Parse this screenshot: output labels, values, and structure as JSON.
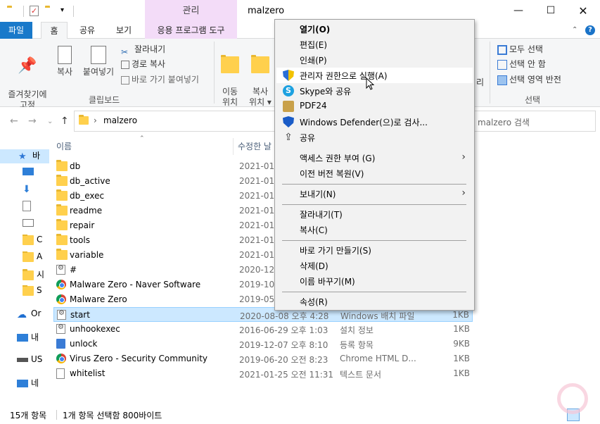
{
  "titlebar": {
    "title": "malzero",
    "context_tab": "관리",
    "min_glyph": "—",
    "max_glyph": "☐",
    "close_glyph": "✕"
  },
  "ribbon_tabs": {
    "file": "파일",
    "home": "홈",
    "share": "공유",
    "view": "보기",
    "app_tools": "응용 프로그램 도구"
  },
  "ribbon": {
    "pin_label": "즐겨찾기에\n고정",
    "copy_label": "복사",
    "paste_label": "붙여넣기",
    "cut_label": "잘라내기",
    "copy_path_label": "경로 복사",
    "paste_shortcut_label": "바로 가기 붙여넣기",
    "clipboard_group": "클립보드",
    "move_label": "이동\n위치 ▾",
    "copyto_label": "복사\n위치 ▾",
    "partial_label": "리",
    "select_all": "모두 선택",
    "select_none": "선택 안 함",
    "invert_selection": "선택 영역 반전",
    "select_group": "선택"
  },
  "address": {
    "path": "malzero",
    "search_placeholder": "malzero 검색"
  },
  "navpane": {
    "items": [
      "바",
      "",
      "",
      "",
      "",
      "C",
      "A",
      "시",
      "S",
      "Or",
      "내",
      "US",
      "네"
    ]
  },
  "columns": {
    "name": "이름",
    "date": "수정한 날"
  },
  "files": [
    {
      "icon": "folder",
      "name": "db",
      "date": "2021-01-",
      "type": "",
      "size": ""
    },
    {
      "icon": "folder",
      "name": "db_active",
      "date": "2021-01-",
      "type": "",
      "size": ""
    },
    {
      "icon": "folder",
      "name": "db_exec",
      "date": "2021-01-",
      "type": "",
      "size": ""
    },
    {
      "icon": "folder",
      "name": "readme",
      "date": "2021-01-",
      "type": "",
      "size": ""
    },
    {
      "icon": "folder",
      "name": "repair",
      "date": "2021-01-",
      "type": "",
      "size": ""
    },
    {
      "icon": "folder",
      "name": "tools",
      "date": "2021-01-",
      "type": "",
      "size": ""
    },
    {
      "icon": "folder",
      "name": "variable",
      "date": "2021-01-",
      "type": "",
      "size": ""
    },
    {
      "icon": "gear-doc",
      "name": "#",
      "date": "2020-12-",
      "type": "",
      "size": ""
    },
    {
      "icon": "chrome",
      "name": "Malware Zero - Naver Software",
      "date": "2019-10-",
      "type": "",
      "size": ""
    },
    {
      "icon": "chrome",
      "name": "Malware Zero",
      "date": "2019-05-",
      "type": "",
      "size": ""
    },
    {
      "icon": "gear-doc",
      "name": "start",
      "date": "2020-08-08 오후 4:28",
      "type": "Windows 배치 파일",
      "size": "1KB",
      "selected": true
    },
    {
      "icon": "gear-doc",
      "name": "unhookexec",
      "date": "2016-06-29 오후 1:03",
      "type": "설치 정보",
      "size": "1KB"
    },
    {
      "icon": "reg",
      "name": "unlock",
      "date": "2019-12-07 오후 8:10",
      "type": "등록 항목",
      "size": "9KB"
    },
    {
      "icon": "chrome",
      "name": "Virus Zero - Security Community",
      "date": "2019-06-20 오전 8:23",
      "type": "Chrome HTML D...",
      "size": "1KB"
    },
    {
      "icon": "doc",
      "name": "whitelist",
      "date": "2021-01-25 오전 11:31",
      "type": "텍스트 문서",
      "size": "1KB"
    }
  ],
  "status": {
    "count": "15개 항목",
    "selection": "1개 항목 선택함 800바이트"
  },
  "context_menu": {
    "open": "열기(O)",
    "edit": "편집(E)",
    "print": "인쇄(P)",
    "run_as_admin": "관리자 권한으로 실행(A)",
    "skype_share": "Skype와 공유",
    "pdf24": "PDF24",
    "defender_scan": "Windows Defender(으)로 검사...",
    "share": "공유",
    "grant_access": "액세스 권한 부여 (G)",
    "restore_versions": "이전 버전 복원(V)",
    "send_to": "보내기(N)",
    "cut": "잘라내기(T)",
    "copy": "복사(C)",
    "create_shortcut": "바로 가기 만들기(S)",
    "delete": "삭제(D)",
    "rename": "이름 바꾸기(M)",
    "properties": "속성(R)",
    "submenu_arrow": "›"
  },
  "colors": {
    "file_tab": "#1979ca",
    "manage_tab": "#f3dcf8",
    "selection": "#cce8ff",
    "menu_bg": "#f2f2f2"
  }
}
